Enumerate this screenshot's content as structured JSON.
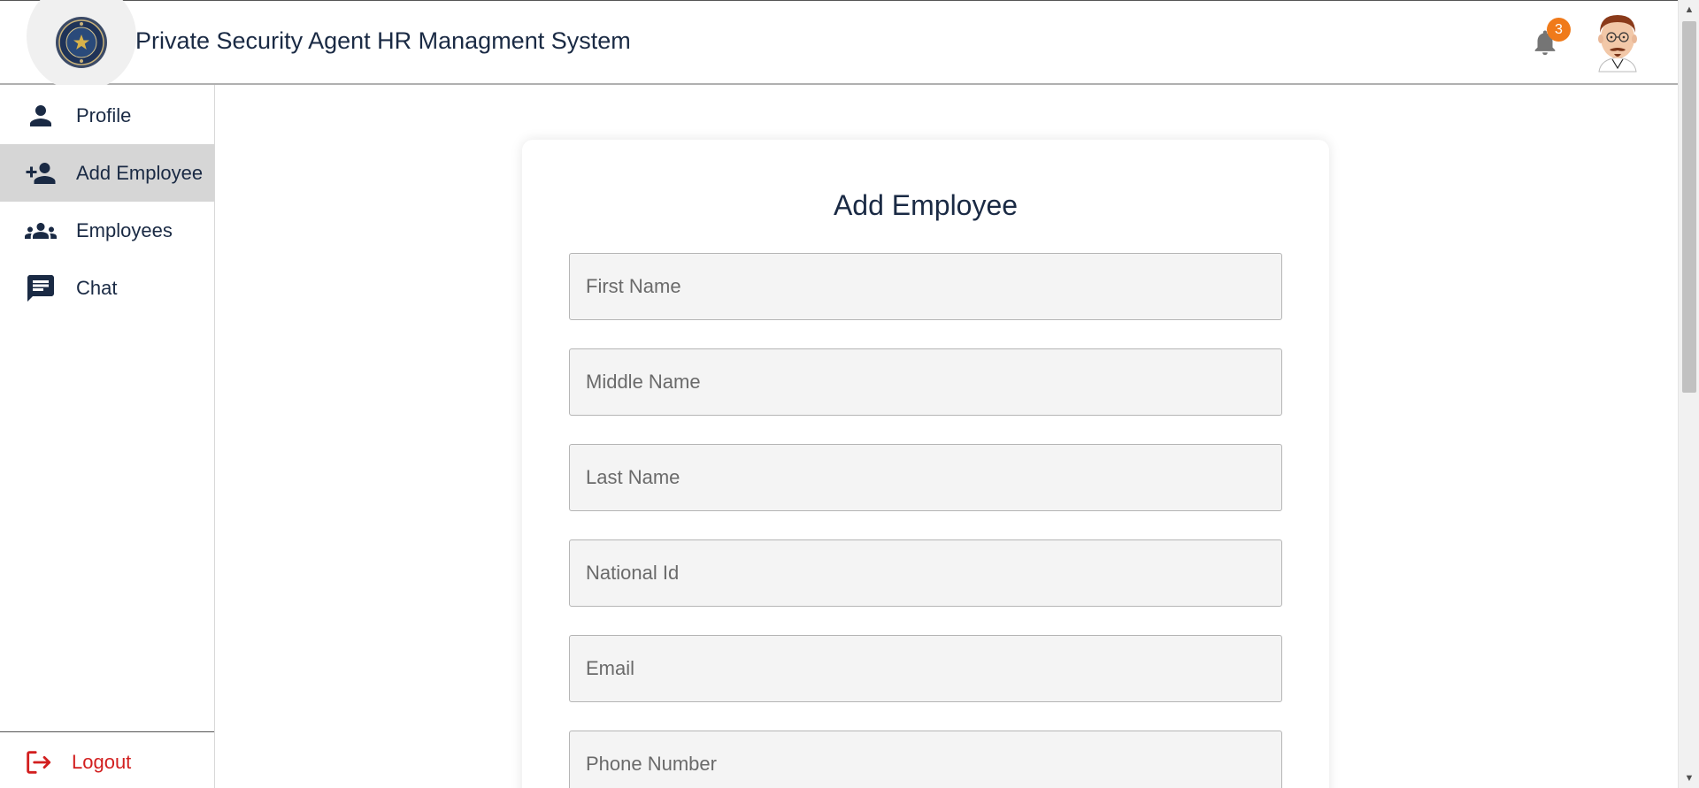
{
  "header": {
    "app_title": "Private Security Agent HR Managment System",
    "notification_count": "3",
    "logo_icon": "police-badge-seal-icon",
    "bell_icon": "bell-icon",
    "avatar_icon": "user-avatar-cartoon"
  },
  "sidebar": {
    "items": [
      {
        "label": "Profile",
        "icon": "person-icon",
        "active": false
      },
      {
        "label": "Add Employee",
        "icon": "person-add-icon",
        "active": true
      },
      {
        "label": "Employees",
        "icon": "group-icon",
        "active": false
      },
      {
        "label": "Chat",
        "icon": "chat-icon",
        "active": false
      }
    ],
    "logout_label": "Logout",
    "logout_icon": "logout-icon"
  },
  "form": {
    "title": "Add Employee",
    "fields": [
      {
        "placeholder": "First Name",
        "value": ""
      },
      {
        "placeholder": "Middle Name",
        "value": ""
      },
      {
        "placeholder": "Last Name",
        "value": ""
      },
      {
        "placeholder": "National Id",
        "value": ""
      },
      {
        "placeholder": "Email",
        "value": ""
      },
      {
        "placeholder": "Phone Number",
        "value": ""
      }
    ]
  },
  "colors": {
    "primary_text": "#1a2a44",
    "active_nav_bg": "#d6d6d6",
    "badge": "#f07a1a",
    "logout": "#d21f1f",
    "field_bg": "#f4f4f4"
  }
}
